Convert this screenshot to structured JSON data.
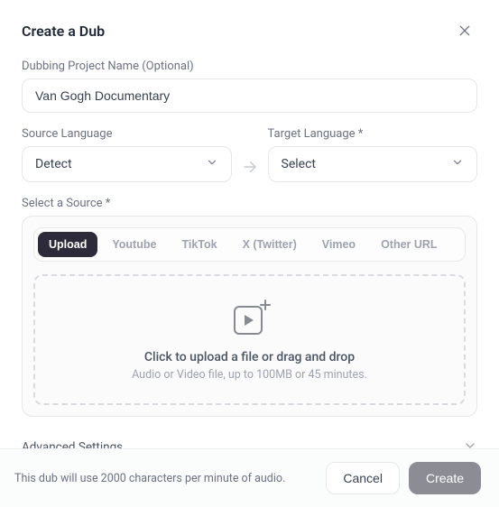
{
  "header": {
    "title": "Create a Dub"
  },
  "projectName": {
    "label": "Dubbing Project Name (Optional)",
    "value": "Van Gogh Documentary"
  },
  "sourceLang": {
    "label": "Source Language",
    "value": "Detect"
  },
  "targetLang": {
    "label": "Target Language *",
    "value": "Select"
  },
  "source": {
    "label": "Select a Source *",
    "tabs": {
      "upload": "Upload",
      "youtube": "Youtube",
      "tiktok": "TikTok",
      "x": "X (Twitter)",
      "vimeo": "Vimeo",
      "other": "Other URL"
    },
    "dropzone": {
      "title": "Click to upload a file or drag and drop",
      "sub": "Audio or Video file, up to 100MB or 45 minutes."
    }
  },
  "advanced": {
    "label": "Advanced Settings"
  },
  "footer": {
    "note": "This dub will use 2000 characters per minute of audio.",
    "cancel": "Cancel",
    "create": "Create"
  }
}
